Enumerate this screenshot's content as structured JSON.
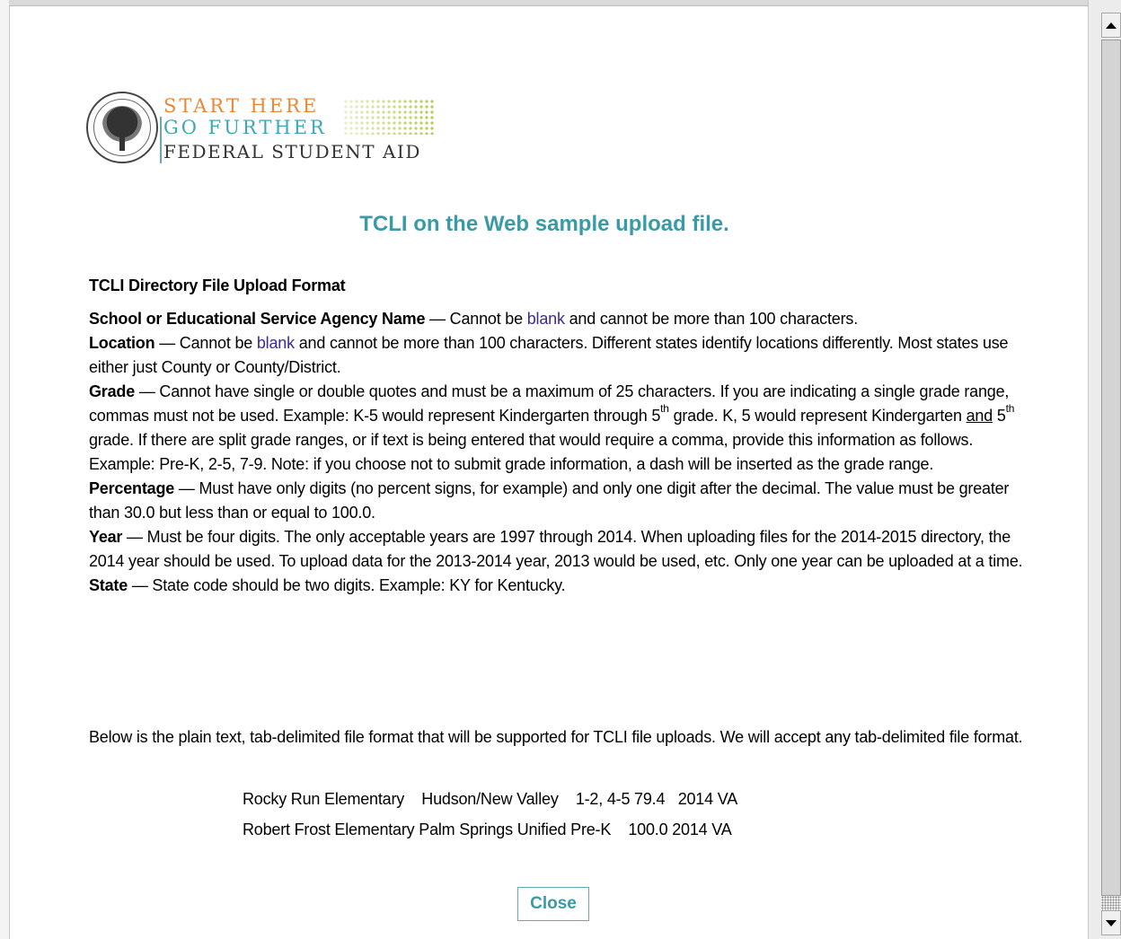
{
  "logo": {
    "line1": "START HERE",
    "line2": "GO FURTHER",
    "line3": "FEDERAL STUDENT AID"
  },
  "title": "TCLI on the Web sample upload file.",
  "section_heading": "TCLI Directory File Upload Format",
  "fields": {
    "school": {
      "label": "School or Educational Service Agency Name",
      "pre": " — Cannot be ",
      "blank": "blank",
      "post": " and cannot be more than 100 characters."
    },
    "location": {
      "label": "Location",
      "pre": " — Cannot be ",
      "blank": "blank",
      "post": " and cannot be more than 100 characters. Different states identify locations differently. Most states use either just County or County/District."
    },
    "grade": {
      "label": "Grade",
      "text1": " — Cannot have single or double quotes and must be a maximum of 25 characters. If you are indicating a single grade range, commas must not be used. Example: K-5 would represent Kindergarten through 5",
      "sup1": "th",
      "text2": " grade. K, 5 would represent Kindergarten ",
      "and": "and",
      "text3": " 5",
      "sup2": "th",
      "text4": " grade. If there are split grade ranges, or if text is being entered that would require a comma, provide this information as follows. Example: Pre-K, 2-5, 7-9. Note: if you choose not to submit grade information, a dash will be inserted as the grade range."
    },
    "percentage": {
      "label": "Percentage",
      "text": " — Must have only digits (no percent signs, for example) and only one digit after the decimal. The value must be greater than 30.0 but less than or equal to 100.0."
    },
    "year": {
      "label": "Year",
      "text": " — Must be four digits. The only acceptable years are 1997 through 2014. When uploading files for the 2014-2015 directory, the 2014 year should be used. To upload data for the 2013-2014 year, 2013 would be used, etc. Only one year can be uploaded at a time."
    },
    "state": {
      "label": "State",
      "text": " — State code should be two digits. Example: KY for Kentucky."
    }
  },
  "plain_note": "Below is the plain text, tab-delimited file format that will be supported for TCLI file uploads. We will accept any tab-delimited file format.",
  "sample_rows": [
    "Rocky Run Elementary    Hudson/New Valley    1-2, 4-5 79.4   2014 VA",
    "Robert Frost Elementary Palm Springs Unified Pre-K    100.0 2014 VA"
  ],
  "close_label": "Close"
}
